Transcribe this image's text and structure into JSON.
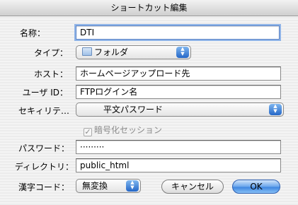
{
  "window": {
    "title": "ショートカット編集"
  },
  "form": {
    "name": {
      "label": "名称：",
      "value": "DTI"
    },
    "type": {
      "label": "タイプ：",
      "value": "フォルダ"
    },
    "host": {
      "label": "ホスト：",
      "value": "ホームページアップロード先"
    },
    "user_id": {
      "label": "ユーザ ID：",
      "value": "FTPログイン名"
    },
    "security": {
      "label": "セキィリテ…",
      "value": "平文パスワード"
    },
    "encrypted_session": {
      "label": "暗号化セッション",
      "checked": true,
      "enabled": false
    },
    "password": {
      "label": "パスワード：",
      "value": "·········"
    },
    "directory": {
      "label": "ディレクトリ：",
      "value": "public_html"
    },
    "kanji_code": {
      "label": "漢字コード：",
      "value": "無変換"
    }
  },
  "buttons": {
    "cancel": "キャンセル",
    "ok": "OK"
  },
  "icons": {
    "type_popup": "folder-icon",
    "popup_arrows": "chevron-up-down-icon",
    "checkbox": "checkmark-icon"
  },
  "colors": {
    "accent": "#3e86e0",
    "focus_ring": "#8fb4e8"
  }
}
